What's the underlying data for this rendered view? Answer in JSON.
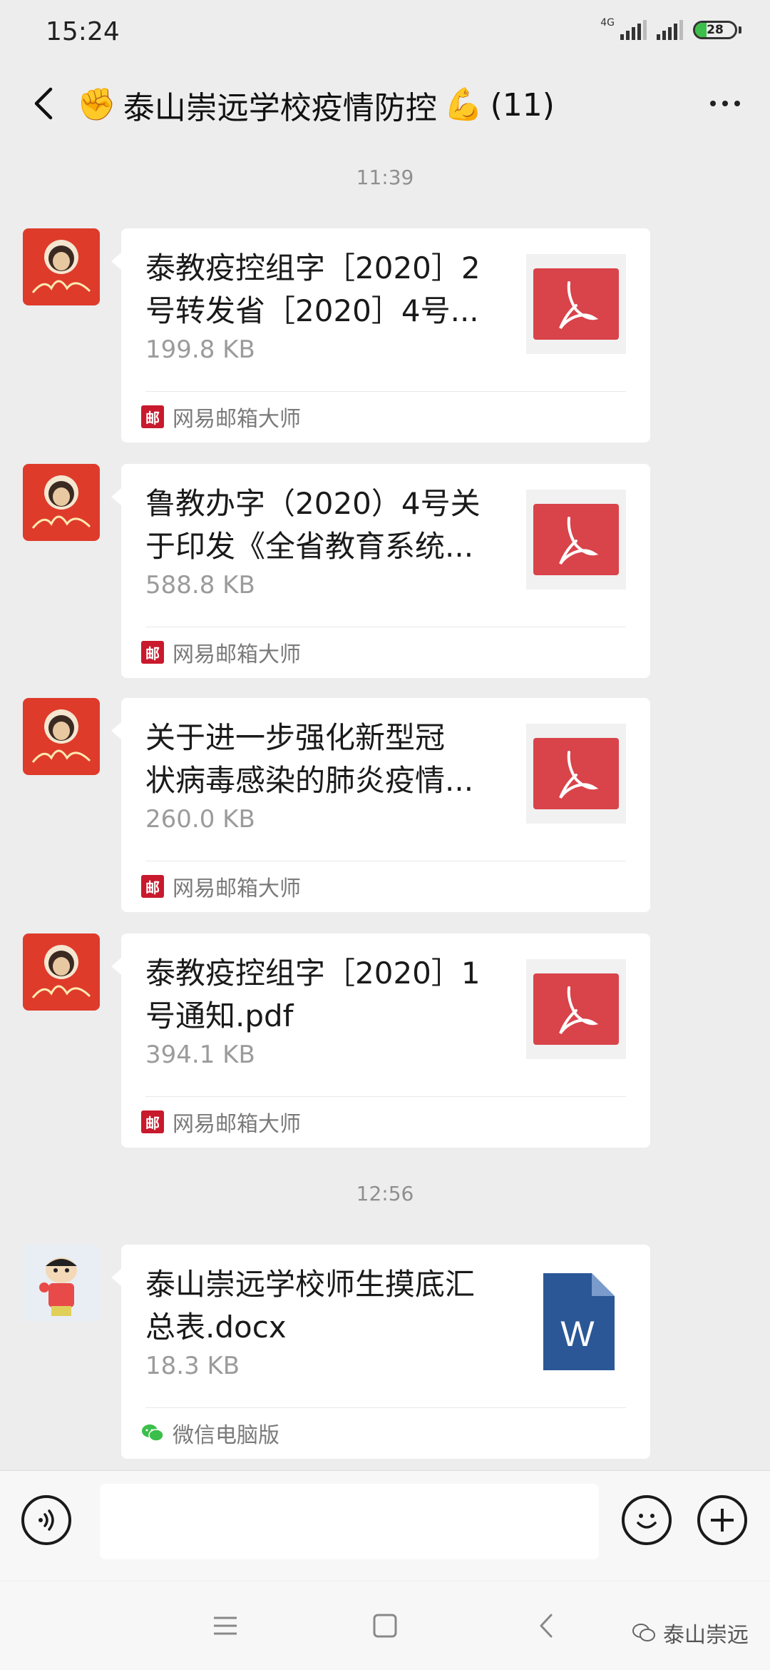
{
  "status_bar": {
    "time": "15:24",
    "network": "4G",
    "battery": "28"
  },
  "header": {
    "title": "泰山崇远学校疫情防控",
    "member_count": "(11)"
  },
  "timestamps": [
    "11:39",
    "12:56"
  ],
  "messages": [
    {
      "name_line1": "泰教疫控组字［2020］2",
      "name_line2": "号转发省［2020］4号...",
      "size": "199.8 KB",
      "file_type": "pdf",
      "source": "网易邮箱大师",
      "source_badge": "邮"
    },
    {
      "name_line1": "鲁教办字（2020）4号关",
      "name_line2": "于印发《全省教育系统...",
      "size": "588.8 KB",
      "file_type": "pdf",
      "source": "网易邮箱大师",
      "source_badge": "邮"
    },
    {
      "name_line1": "关于进一步强化新型冠",
      "name_line2": "状病毒感染的肺炎疫情...",
      "size": "260.0 KB",
      "file_type": "pdf",
      "source": "网易邮箱大师",
      "source_badge": "邮"
    },
    {
      "name_line1": "泰教疫控组字［2020］1",
      "name_line2": "号通知.pdf",
      "size": "394.1 KB",
      "file_type": "pdf",
      "source": "网易邮箱大师",
      "source_badge": "邮"
    },
    {
      "name_line1": "泰山崇远学校师生摸底汇",
      "name_line2": "总表.docx",
      "size": "18.3 KB",
      "file_type": "docx",
      "word_letter": "W",
      "source": "微信电脑版"
    }
  ],
  "watermark": "泰山崇远",
  "colors": {
    "pdf_red": "#d9434a",
    "word_blue": "#2b5797",
    "avatar_red": "#de3b2b",
    "wechat_green": "#3bbf4a"
  }
}
